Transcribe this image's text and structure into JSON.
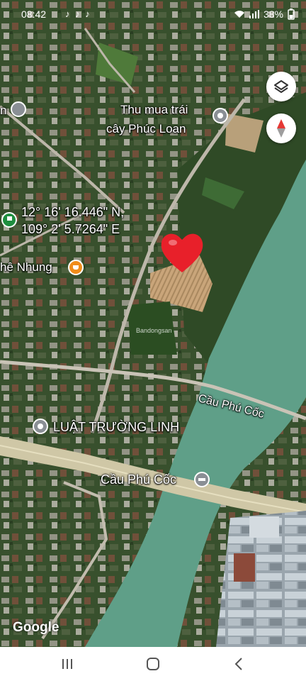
{
  "status_bar": {
    "time": "08:42",
    "app_icons": "♪ ♪ ♪",
    "battery": "38%"
  },
  "map": {
    "places": {
      "fruit_shop_line1": "Thu mua trái",
      "fruit_shop_line2": "cây Phúc Loan",
      "cafe": "hê Nhung",
      "law_office": "LUẬT TRƯỜNG LINH",
      "bridge_poi": "Cầu Phú Cốc",
      "road_label": "Cầu Phú Cốc",
      "coord_lat": "12° 16' 16.446\" N,",
      "coord_lon": "109° 2' 5.7264\" E",
      "watermark": "Bandongsan",
      "left_edge": "n"
    },
    "logo": "Google",
    "colors": {
      "river": "#5f9f88",
      "poi_gray": "#8a8f95",
      "pin_green": "#1e8e3e",
      "cafe_orange": "#f08c1a",
      "heart": "#e8202a"
    },
    "controls": {
      "layers": "layers-icon",
      "compass": "compass-icon"
    }
  },
  "nav_bar": {
    "recents": "recents-icon",
    "home": "home-icon",
    "back": "back-icon"
  }
}
